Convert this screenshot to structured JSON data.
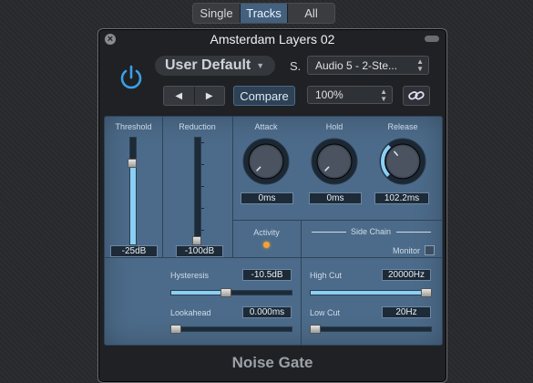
{
  "view_modes": {
    "single": "Single",
    "tracks": "Tracks",
    "all": "All",
    "active": "Tracks"
  },
  "window": {
    "title": "Amsterdam Layers 02"
  },
  "header": {
    "preset": "User Default",
    "sidechain_label": "S.",
    "sidechain_source": "Audio 5 - 2-Ste...",
    "compare": "Compare",
    "zoom": "100%"
  },
  "threshold": {
    "label": "Threshold",
    "value": "-25dB",
    "level": 0.78
  },
  "reduction": {
    "label": "Reduction",
    "value": "-100dB",
    "level": 0.0
  },
  "attack": {
    "label": "Attack",
    "value": "0ms",
    "level": 0.0
  },
  "hold": {
    "label": "Hold",
    "value": "0ms",
    "level": 0.0
  },
  "release": {
    "label": "Release",
    "value": "102.2ms",
    "level": 0.35
  },
  "activity": {
    "label": "Activity"
  },
  "hysteresis": {
    "label": "Hysteresis",
    "value": "-10.5dB",
    "level": 0.45
  },
  "lookahead": {
    "label": "Lookahead",
    "value": "0.000ms",
    "level": 0.0
  },
  "side_chain": {
    "title": "Side Chain",
    "monitor_label": "Monitor",
    "high_cut_label": "High Cut",
    "high_cut_value": "20000Hz",
    "high_cut_level": 1.0,
    "low_cut_label": "Low Cut",
    "low_cut_value": "20Hz",
    "low_cut_level": 0.0
  },
  "footer": {
    "name": "Noise Gate"
  },
  "colors": {
    "panel": "#4c6b8a",
    "accent": "#8ccff5",
    "power": "#3aa0e8",
    "led": "#f2a23a"
  }
}
